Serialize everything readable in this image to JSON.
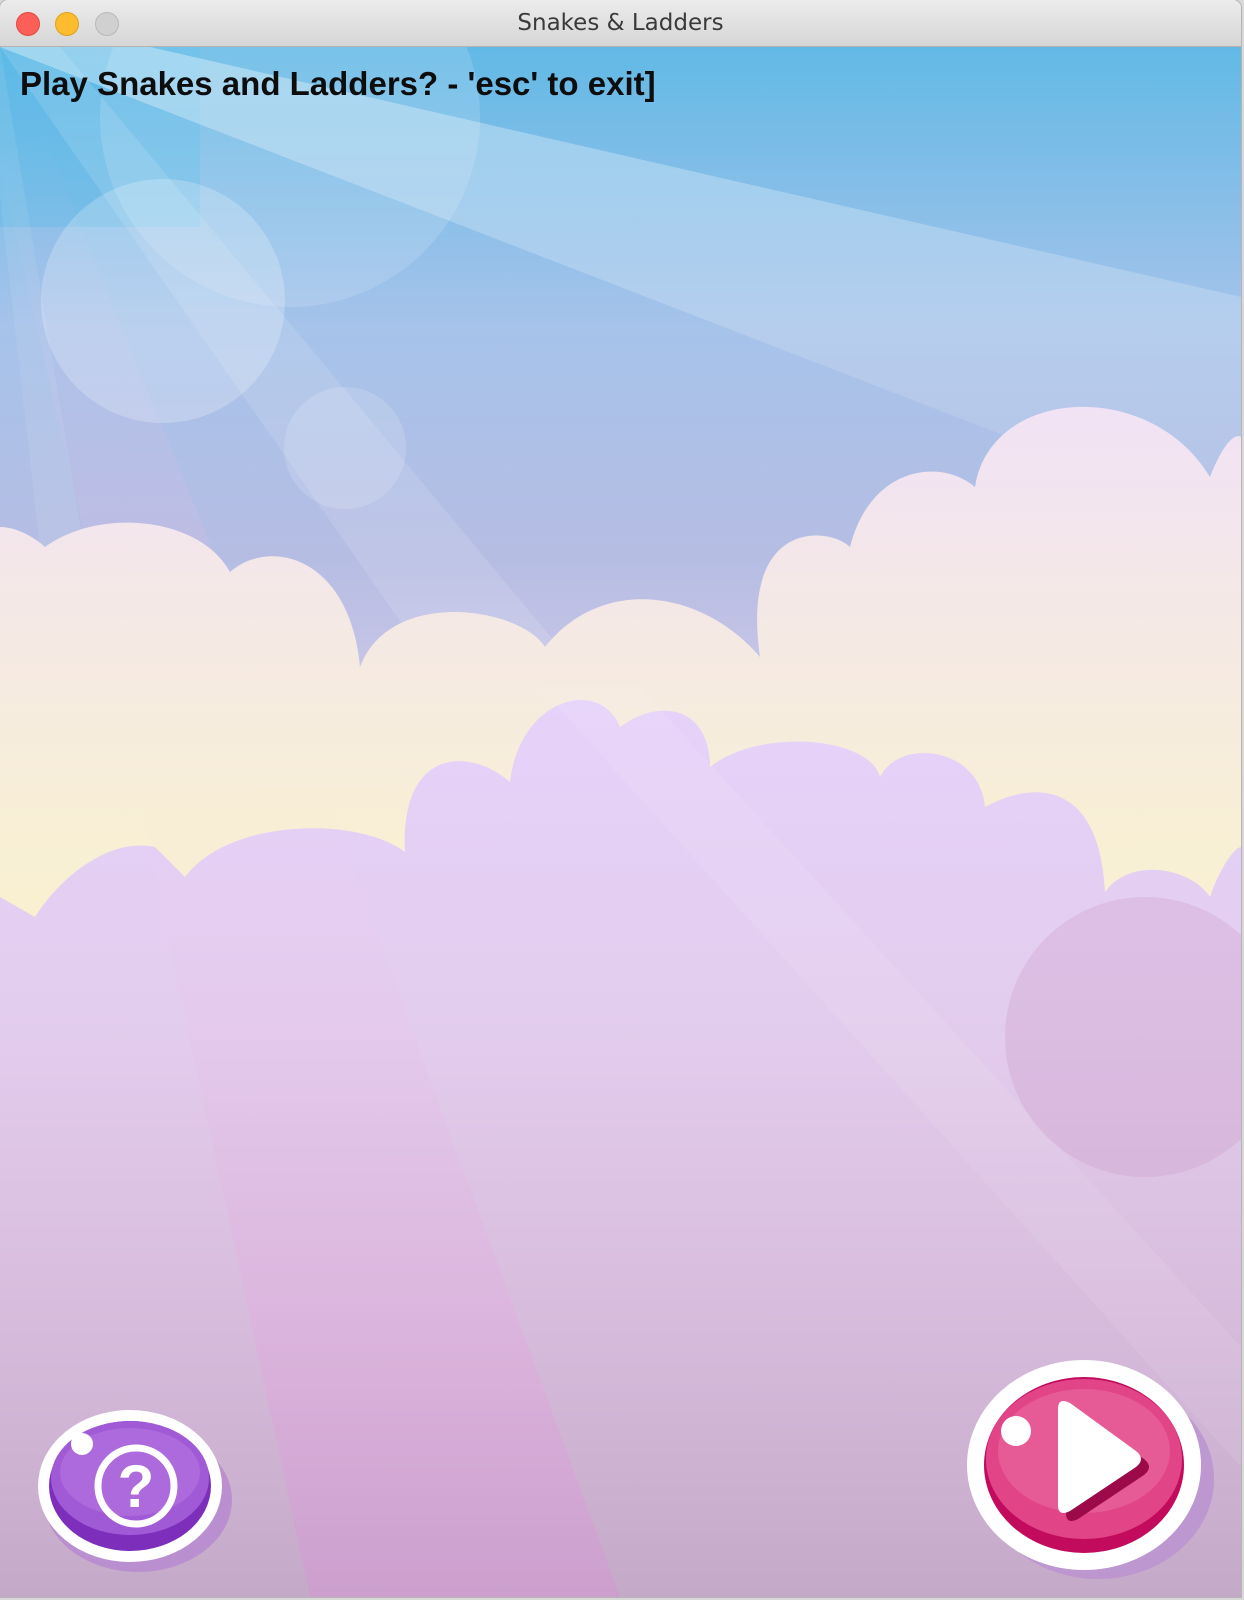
{
  "window": {
    "title": "Snakes & Ladders",
    "controls": [
      "close",
      "minimize",
      "zoom"
    ]
  },
  "game": {
    "prompt": "Play Snakes and Ladders? - 'esc' to exit]",
    "buttons": {
      "help": {
        "icon": "question-mark-icon",
        "glyph": "?",
        "color": "#8f3cc9"
      },
      "play": {
        "icon": "play-triangle-icon",
        "color": "#d8136a"
      }
    }
  },
  "colors": {
    "sky_top": "#4db8e6",
    "sky_mid": "#b2bde4",
    "horizon": "#fdf6bf",
    "cloud_lilac": "#e3cff8",
    "ground_bottom": "#c4a9c8"
  }
}
